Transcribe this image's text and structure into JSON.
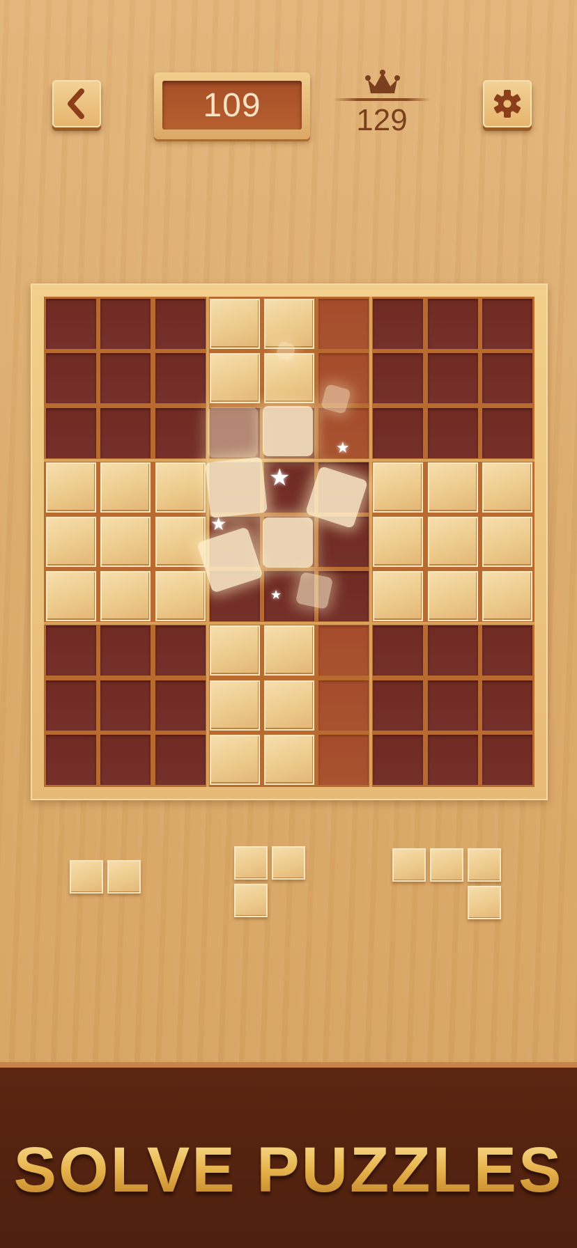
{
  "header": {
    "back_icon": "chevron-left-icon",
    "score": "109",
    "best_icon": "crown-icon",
    "best_score": "129",
    "settings_icon": "gear-icon"
  },
  "board": {
    "size": 9,
    "filled_cells": [
      [
        0,
        3
      ],
      [
        0,
        4
      ],
      [
        1,
        3
      ],
      [
        1,
        4
      ],
      [
        3,
        0
      ],
      [
        3,
        1
      ],
      [
        3,
        2
      ],
      [
        3,
        6
      ],
      [
        3,
        7
      ],
      [
        3,
        8
      ],
      [
        4,
        0
      ],
      [
        4,
        1
      ],
      [
        4,
        2
      ],
      [
        4,
        6
      ],
      [
        4,
        7
      ],
      [
        4,
        8
      ],
      [
        5,
        0
      ],
      [
        5,
        1
      ],
      [
        5,
        2
      ],
      [
        5,
        6
      ],
      [
        5,
        7
      ],
      [
        5,
        8
      ],
      [
        6,
        3
      ],
      [
        6,
        4
      ],
      [
        7,
        3
      ],
      [
        7,
        4
      ],
      [
        8,
        3
      ],
      [
        8,
        4
      ]
    ],
    "highlighted_cells": [
      [
        0,
        5
      ],
      [
        1,
        5
      ],
      [
        2,
        5
      ],
      [
        6,
        5
      ],
      [
        7,
        5
      ],
      [
        8,
        5
      ]
    ],
    "clearing_column": 5
  },
  "pieces": [
    {
      "name": "piece-horizontal-2",
      "cells": [
        [
          0,
          0
        ],
        [
          0,
          1
        ]
      ]
    },
    {
      "name": "piece-corner-3",
      "cells": [
        [
          0,
          0
        ],
        [
          0,
          1
        ],
        [
          1,
          0
        ]
      ]
    },
    {
      "name": "piece-hook-4",
      "cells": [
        [
          0,
          0
        ],
        [
          0,
          1
        ],
        [
          0,
          2
        ],
        [
          1,
          2
        ]
      ]
    }
  ],
  "banner": {
    "text": "SOLVE PUZZLES"
  },
  "colors": {
    "board_empty": "#72302a",
    "board_highlight": "#a65030",
    "block_light": "#edcb8c",
    "banner_bg": "#521f0e",
    "banner_text": "#e6b24b"
  }
}
